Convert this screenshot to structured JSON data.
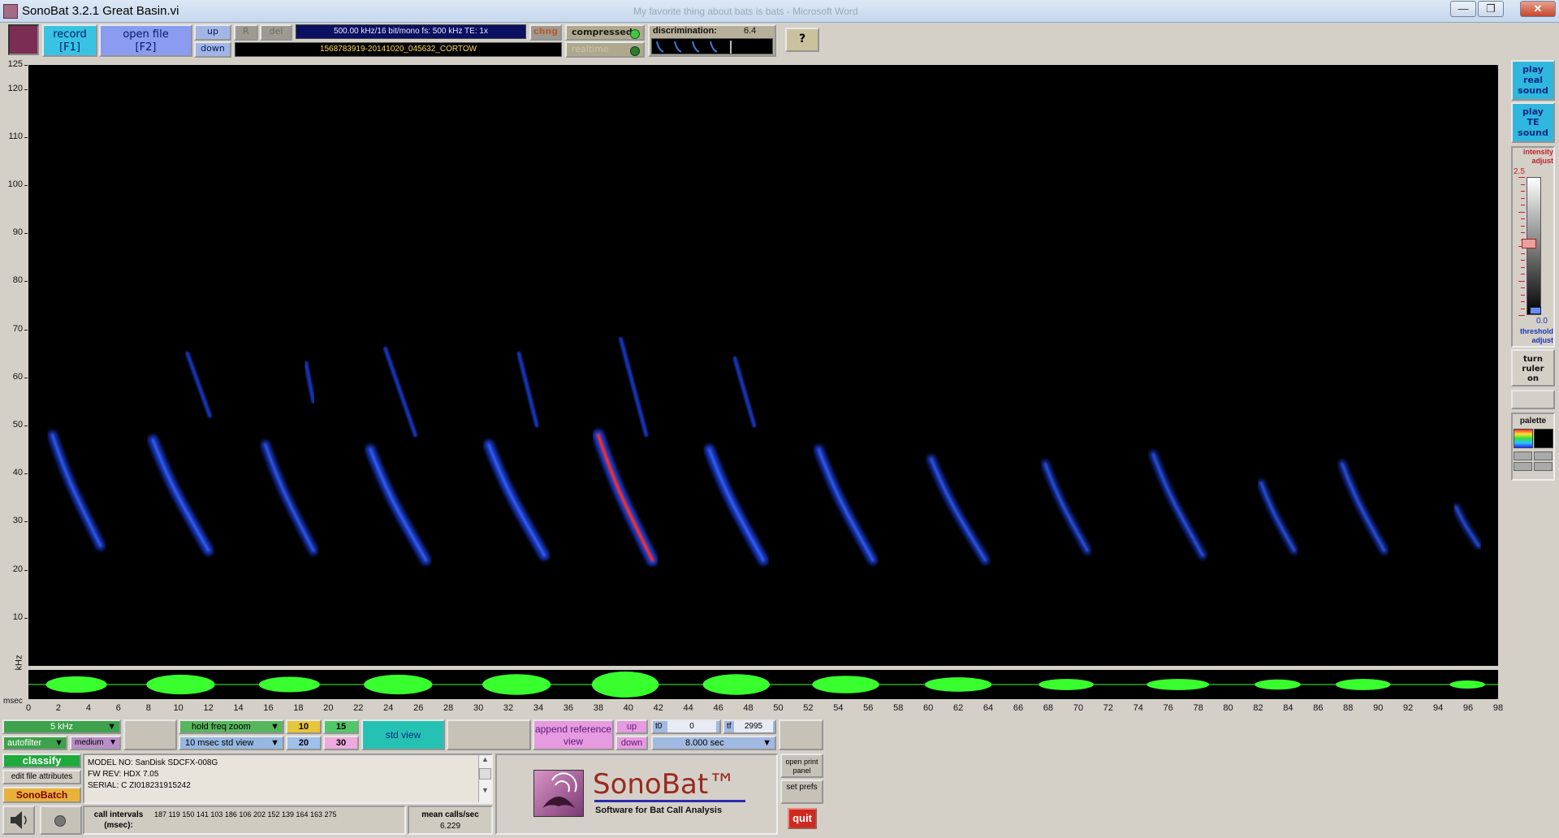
{
  "window": {
    "title": "SonoBat 3.2.1 Great Basin.vi",
    "background_title": "My favorite thing about bats is bats - Microsoft Word",
    "minimize": "—",
    "restore": "❐",
    "close": "✕"
  },
  "toolbar": {
    "record_label": "record",
    "record_key": "[F1]",
    "open_label": "open file",
    "open_key": "[F2]",
    "up_label": "up",
    "down_label": "down",
    "r_label": "R",
    "del_label": "del",
    "sample_info": "500.00 kHz/16 bit/mono    fs: 500 kHz    TE:  1x",
    "chng_label": "chng",
    "file_name": "1568783919-20141020_045632_CORTOW",
    "compressed_label": "compressed",
    "realtime_label": "realtime",
    "discrimination_label": "discrimination:",
    "discrimination_value": "6.4",
    "help_label": "?"
  },
  "spectrogram": {
    "y_ticks": [
      "125",
      "120",
      "110",
      "100",
      "90",
      "80",
      "70",
      "60",
      "50",
      "40",
      "30",
      "20",
      "10"
    ],
    "y_unit": "kHz",
    "x_unit": "msec",
    "x_ticks": [
      "0",
      "2",
      "4",
      "6",
      "8",
      "10",
      "12",
      "14",
      "16",
      "18",
      "20",
      "22",
      "24",
      "26",
      "28",
      "30",
      "32",
      "34",
      "36",
      "38",
      "40",
      "42",
      "44",
      "46",
      "48",
      "50",
      "52",
      "54",
      "56",
      "58",
      "60",
      "62",
      "64",
      "66",
      "68",
      "70",
      "72",
      "74",
      "76",
      "78",
      "80",
      "82",
      "84",
      "86",
      "88",
      "90",
      "92",
      "94",
      "96",
      "98"
    ],
    "x_range_msec": [
      0,
      98
    ],
    "y_range_khz": [
      0,
      125
    ],
    "colors": {
      "background": "#000000",
      "call": "#1d3cd6",
      "call_hot": "#ff3020",
      "waveform": "#39ff2e"
    },
    "calls": [
      {
        "t_start": 1.6,
        "t_end": 4.8,
        "f_high": 48,
        "f_low": 25,
        "harmonic": null,
        "amp": 0.55
      },
      {
        "t_start": 8.3,
        "t_end": 12.0,
        "f_high": 47,
        "f_low": 24,
        "harmonic": [
          10.6,
          12.1,
          65,
          52
        ],
        "amp": 0.7
      },
      {
        "t_start": 15.8,
        "t_end": 19.0,
        "f_high": 46,
        "f_low": 24,
        "harmonic": [
          18.5,
          19.0,
          63,
          55
        ],
        "amp": 0.5
      },
      {
        "t_start": 22.8,
        "t_end": 26.5,
        "f_high": 45,
        "f_low": 22,
        "harmonic": [
          23.8,
          25.8,
          66,
          48
        ],
        "amp": 0.7
      },
      {
        "t_start": 30.7,
        "t_end": 34.4,
        "f_high": 46,
        "f_low": 23,
        "harmonic": [
          32.7,
          33.9,
          65,
          50
        ],
        "amp": 0.75
      },
      {
        "t_start": 38.0,
        "t_end": 41.6,
        "f_high": 48,
        "f_low": 22,
        "harmonic": [
          39.5,
          41.2,
          68,
          48
        ],
        "amp": 1.0,
        "hot": true
      },
      {
        "t_start": 45.4,
        "t_end": 49.0,
        "f_high": 45,
        "f_low": 22,
        "harmonic": [
          47.1,
          48.4,
          64,
          50
        ],
        "amp": 0.75
      },
      {
        "t_start": 52.7,
        "t_end": 56.3,
        "f_high": 45,
        "f_low": 22,
        "harmonic": null,
        "amp": 0.6
      },
      {
        "t_start": 60.2,
        "t_end": 63.8,
        "f_high": 43,
        "f_low": 22,
        "harmonic": null,
        "amp": 0.45
      },
      {
        "t_start": 67.8,
        "t_end": 70.6,
        "f_high": 42,
        "f_low": 24,
        "harmonic": null,
        "amp": 0.3
      },
      {
        "t_start": 75.0,
        "t_end": 78.3,
        "f_high": 44,
        "f_low": 23,
        "harmonic": null,
        "amp": 0.3
      },
      {
        "t_start": 82.2,
        "t_end": 84.4,
        "f_high": 38,
        "f_low": 24,
        "harmonic": null,
        "amp": 0.25
      },
      {
        "t_start": 87.6,
        "t_end": 90.4,
        "f_high": 42,
        "f_low": 24,
        "harmonic": null,
        "amp": 0.3
      },
      {
        "t_start": 95.2,
        "t_end": 96.7,
        "f_high": 33,
        "f_low": 25,
        "harmonic": null,
        "amp": 0.15
      }
    ]
  },
  "right_panel": {
    "play_real": [
      "play",
      "real",
      "sound"
    ],
    "play_te": [
      "play",
      "TE",
      "sound"
    ],
    "intensity_label": "intensity adjust",
    "intensity_value": "2.5",
    "threshold_value": "0.0",
    "threshold_label": "threshold adjust",
    "ruler": [
      "turn",
      "ruler",
      "on"
    ],
    "palette_label": "palette"
  },
  "controls": {
    "filter_freq": "5 kHz",
    "autofilter": "autofilter",
    "filter_level": "medium",
    "freq_zoom": "hold freq zoom",
    "std_view_select": "10 msec std view",
    "zoom_10": "10",
    "zoom_15": "15",
    "zoom_20": "20",
    "zoom_30": "30",
    "std_view_button": "std view",
    "append_label": "append reference view",
    "up_label": "up",
    "down_label": "down",
    "t0_label": "t0",
    "t0_value": "0",
    "tf_label": "tf",
    "tf_value": "2995",
    "duration": "8.000 sec",
    "classify": "classify",
    "edit_attributes": "edit file attributes",
    "sonobatch": "SonoBatch",
    "metadata": [
      "MODEL NO:  SanDisk SDCFX-008G",
      "FW REV:    HDX 7.05",
      "SERIAL:    C ZI018231915242"
    ],
    "call_intervals_label": "call intervals",
    "call_intervals_unit": "(msec):",
    "call_intervals": "187  119  150  141  103  186  106  202  152  139  164  163  275",
    "mean_calls_label": "mean calls/sec",
    "mean_calls_value": "6.229",
    "print_panel": "open print panel",
    "set_prefs": "set prefs",
    "quit": "quit"
  },
  "logo": {
    "title": "SonoBat™",
    "subtitle": "Software for Bat Call Analysis"
  }
}
